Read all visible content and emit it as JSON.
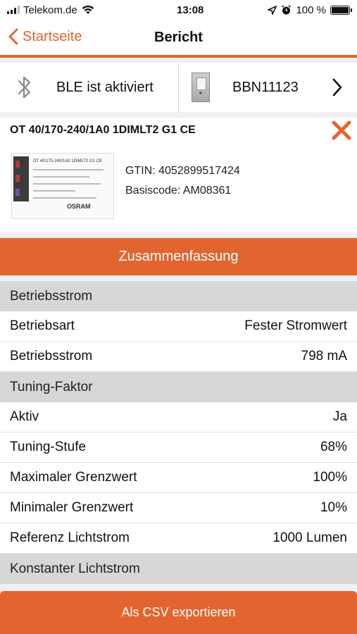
{
  "status_bar": {
    "carrier": "Telekom.de",
    "time": "13:08",
    "battery_percent": "100 %",
    "signal_icon": "signal-bars-icon",
    "wifi_icon": "wifi-icon",
    "location_icon": "location-arrow-icon",
    "alarm_icon": "alarm-clock-icon",
    "battery_icon": "battery-icon"
  },
  "nav": {
    "back_label": "Startseite",
    "title": "Bericht",
    "accent_color": "#e2652f"
  },
  "device_bar": {
    "ble_label": "BLE ist aktiviert",
    "ble_icon": "bluetooth-icon",
    "device_label": "BBN11123",
    "device_icon": "ble-device-icon",
    "chevron_icon": "chevron-right-icon"
  },
  "product": {
    "title": "OT 40/170-240/1A0 1DIMLT2 G1 CE",
    "gtin": "GTIN: 4052899517424",
    "basiscode": "Basiscode: AM08361",
    "image_brand": "OSRAM",
    "image_model": "OT 40/170-240/1A0 1DIMLT2 G1 CE",
    "close_icon": "close-icon"
  },
  "summary_label": "Zusammenfassung",
  "sections": [
    {
      "header": "Betriebsstrom",
      "rows": [
        {
          "label": "Betriebsart",
          "value": "Fester Stromwert"
        },
        {
          "label": "Betriebsstrom",
          "value": "798 mA"
        }
      ]
    },
    {
      "header": "Tuning-Faktor",
      "rows": [
        {
          "label": "Aktiv",
          "value": "Ja"
        },
        {
          "label": "Tuning-Stufe",
          "value": "68%"
        },
        {
          "label": "Maximaler Grenzwert",
          "value": "100%"
        },
        {
          "label": "Minimaler Grenzwert",
          "value": "10%"
        },
        {
          "label": "Referenz Lichtstrom",
          "value": "1000 Lumen"
        }
      ]
    },
    {
      "header": "Konstanter Lichtstrom",
      "rows": []
    }
  ],
  "export_label": "Als CSV exportieren"
}
